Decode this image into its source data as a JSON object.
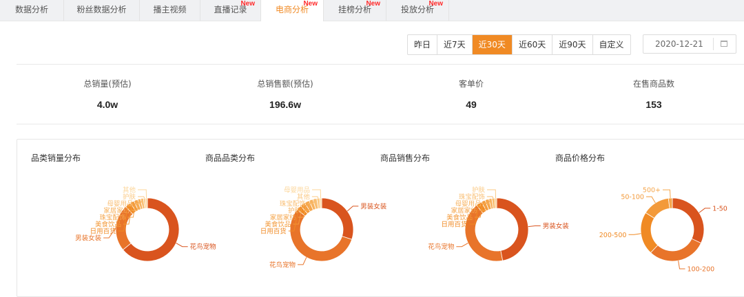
{
  "tabs": [
    {
      "label": "数据分析",
      "badge": ""
    },
    {
      "label": "粉丝数据分析",
      "badge": ""
    },
    {
      "label": "播主视频",
      "badge": ""
    },
    {
      "label": "直播记录",
      "badge": "New"
    },
    {
      "label": "电商分析",
      "badge": "New",
      "active": true
    },
    {
      "label": "挂榜分析",
      "badge": "New"
    },
    {
      "label": "投放分析",
      "badge": "New"
    }
  ],
  "range": {
    "options": [
      "昨日",
      "近7天",
      "近30天",
      "近60天",
      "近90天",
      "自定义"
    ],
    "active_index": 2
  },
  "date_value": "2020-12-21",
  "stats": [
    {
      "label": "总销量(预估)",
      "value": "4.0w"
    },
    {
      "label": "总销售额(预估)",
      "value": "196.6w"
    },
    {
      "label": "客单价",
      "value": "49"
    },
    {
      "label": "在售商品数",
      "value": "153"
    }
  ],
  "chart_data": [
    {
      "type": "pie",
      "title": "品类销量分布",
      "categories": [
        "花鸟宠物",
        "男装女装",
        "日用百货",
        "美食饮品",
        "珠宝配饰",
        "家居家纺",
        "母婴用品",
        "护肤",
        "其他"
      ],
      "values": [
        64,
        24,
        3,
        2,
        2,
        1.5,
        1.5,
        1,
        1
      ]
    },
    {
      "type": "pie",
      "title": "商品品类分布",
      "categories": [
        "男装女装",
        "花鸟宠物",
        "日用百货",
        "美食饮品",
        "家居家纺",
        "护肤",
        "珠宝配饰",
        "其他",
        "母婴用品"
      ],
      "values": [
        30,
        56,
        2.5,
        2.5,
        2.5,
        2,
        2,
        1.5,
        1
      ]
    },
    {
      "type": "pie",
      "title": "商品销售分布",
      "categories": [
        "男装女装",
        "花鸟宠物",
        "日用百货",
        "美食饮品",
        "家居家纺",
        "母婴用品",
        "珠宝配饰",
        "护肤"
      ],
      "values": [
        47,
        42,
        3,
        2,
        2,
        1.5,
        1.5,
        1
      ]
    },
    {
      "type": "pie",
      "title": "商品价格分布",
      "categories": [
        "1-50",
        "100-200",
        "200-500",
        "50-100",
        "500+"
      ],
      "values": [
        32,
        30,
        22,
        14,
        2
      ]
    }
  ],
  "colors": {
    "accent": "#f08a24",
    "donut": [
      "#d9541e",
      "#e8742a",
      "#f08a24",
      "#f39a3a",
      "#f5a64c",
      "#f7b25e",
      "#f9be72",
      "#fbca86",
      "#fcd69a"
    ],
    "badge": "#ff2a2a"
  }
}
